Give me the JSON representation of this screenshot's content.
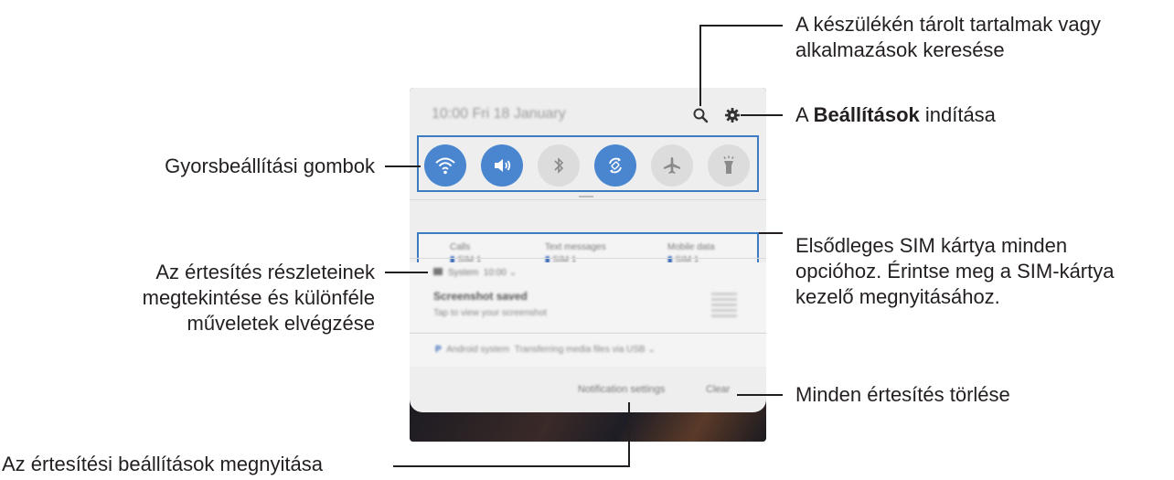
{
  "callouts": {
    "search": "A készülékén tárolt tartalmak vagy",
    "search_line2": "alkalmazások keresése",
    "settings_prefix": "A ",
    "settings_bold": "Beállítások",
    "settings_suffix": " indítása",
    "quick_settings": "Gyorsbeállítási gombok",
    "sim_line1": "Elsődleges SIM kártya minden",
    "sim_line2": "opcióhoz. Érintse meg a SIM-kártya",
    "sim_line3": "kezelő megnyitásához.",
    "notif_line1": "Az értesítés részleteinek",
    "notif_line2": "megtekintése és különféle",
    "notif_line3": "műveletek elvégzése",
    "clear": "Minden értesítés törlése",
    "notif_settings": "Az értesítési beállítások megnyitása"
  },
  "phone": {
    "status": "10:00  Fri 18 January",
    "quick_settings": [
      {
        "name": "wifi-icon",
        "state": "on"
      },
      {
        "name": "sound-icon",
        "state": "on"
      },
      {
        "name": "bluetooth-icon",
        "state": "off"
      },
      {
        "name": "auto-rotate-icon",
        "state": "on"
      },
      {
        "name": "airplane-icon",
        "state": "off"
      },
      {
        "name": "flashlight-icon",
        "state": "off"
      }
    ],
    "sim": [
      {
        "label": "Calls",
        "value": "SIM 1"
      },
      {
        "label": "Text messages",
        "value": "SIM 1"
      },
      {
        "label": "Mobile data",
        "value": "SIM 1"
      }
    ],
    "notif1": {
      "app": "System",
      "time": "10:00",
      "title": "Screenshot saved",
      "body": "Tap to view your screenshot"
    },
    "notif2": {
      "app": "Android system",
      "text": "Transferring media files via USB"
    },
    "buttons": {
      "notification_settings": "Notification settings",
      "clear": "Clear"
    }
  }
}
